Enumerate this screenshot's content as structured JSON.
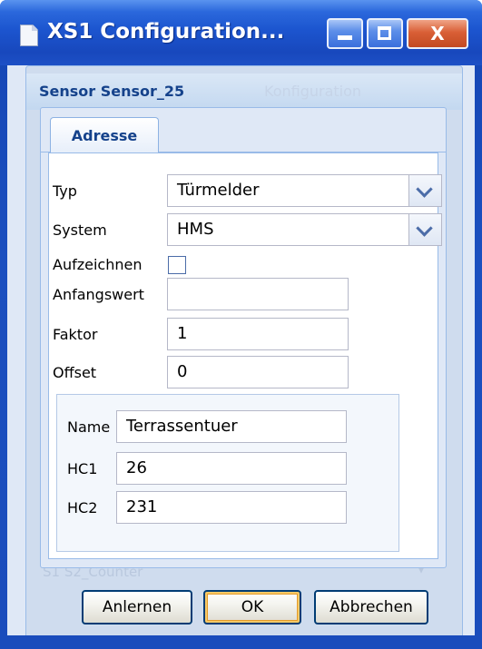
{
  "window": {
    "title": "XS1 Configuration...",
    "close_glyph": "X"
  },
  "panel": {
    "title": "Sensor Sensor_25",
    "ghost_tab": "Konfiguration",
    "ghost_bottom_text": "S1    S2_Counter"
  },
  "dialog": {
    "tab_label": "Adresse",
    "form": {
      "typ": {
        "label": "Typ",
        "value": "Türmelder"
      },
      "system": {
        "label": "System",
        "value": "HMS"
      },
      "aufzeichnen": {
        "label": "Aufzeichnen",
        "checked": false
      },
      "anfangswert": {
        "label": "Anfangswert",
        "value": ""
      },
      "faktor": {
        "label": "Faktor",
        "value": "1"
      },
      "offset": {
        "label": "Offset",
        "value": "0"
      }
    },
    "address": {
      "name": {
        "label": "Name",
        "value": "Terrassentuer"
      },
      "hc1": {
        "label": "HC1",
        "value": "26"
      },
      "hc2": {
        "label": "HC2",
        "value": "231"
      }
    }
  },
  "buttons": {
    "anlernen": "Anlernen",
    "ok": "OK",
    "abbrechen": "Abbrechen"
  },
  "colors": {
    "titlebar": "#1c55cf",
    "panel_title": "#15428b",
    "border": "#99bbe8"
  }
}
